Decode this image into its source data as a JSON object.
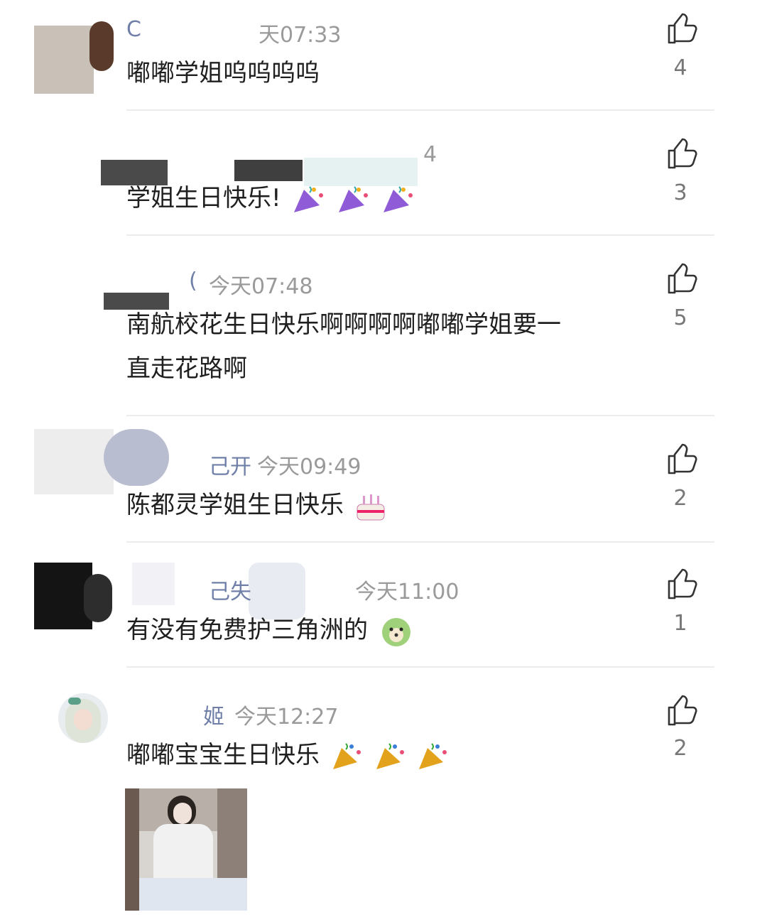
{
  "comments": [
    {
      "name": "C",
      "time": "天07:33",
      "text": "嘟嘟学姐呜呜呜呜",
      "likes": "4"
    },
    {
      "name": "",
      "time": "4",
      "text": "学姐生日快乐!",
      "likes": "3"
    },
    {
      "name": "(",
      "time": "今天07:48",
      "text_line1": "南航校花生日快乐啊啊啊啊嘟嘟学姐要一",
      "text_line2": "直走花路啊",
      "likes": "5"
    },
    {
      "name": "己开",
      "time": "今天09:49",
      "text": "陈都灵学姐生日快乐",
      "likes": "2"
    },
    {
      "name": "己失",
      "time": "今天11:00",
      "text": "有没有免费护三角洲的",
      "likes": "1"
    },
    {
      "name": "姬",
      "time": "今天12:27",
      "text": "嘟嘟宝宝生日快乐",
      "likes": "2"
    }
  ],
  "icons": {
    "like": "thumbs-up-icon",
    "party": "party-popper-icon",
    "cake": "birthday-cake-icon",
    "dog": "dog-face-icon"
  },
  "colors": {
    "divider": "#ececec",
    "meta": "#9a9a9a",
    "text": "#1f1f1f",
    "count": "#777777"
  }
}
